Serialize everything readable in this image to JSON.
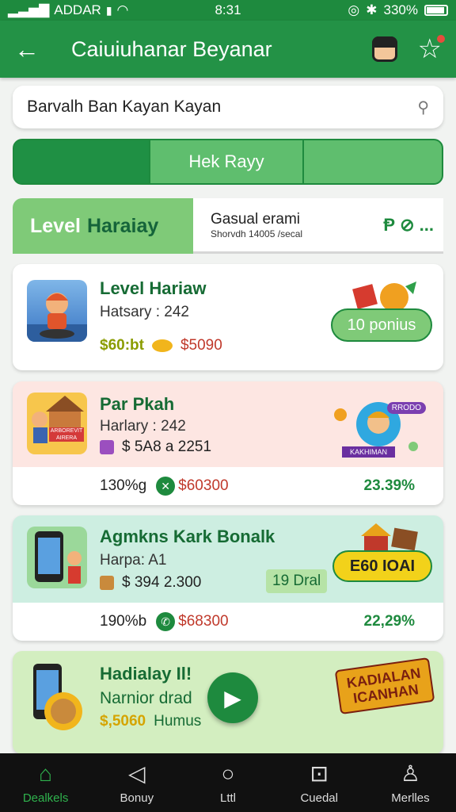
{
  "status_bar": {
    "carrier": "ADDAR",
    "time": "8:31",
    "battery": "330%"
  },
  "app_bar": {
    "title": "Caiuiuhanar Beyanar",
    "back_icon": "arrow-left-icon",
    "avatar_icon": "avatar-icon",
    "star_icon": "star-icon"
  },
  "search": {
    "value": "Barvalh Ban Kayan Kayan",
    "icon": "search-icon"
  },
  "segments": [
    "",
    "Hek Rayy",
    ""
  ],
  "tabs": {
    "active_a": "Level",
    "active_b": "Haraiay",
    "other_title": "Gasual erami",
    "other_sub": "Shorvdh 14005 /secal",
    "other_icons": "Ᵽ ⊘ ..."
  },
  "cards": [
    {
      "title": "Level Hariaw",
      "subtitle": "Hatsary : 242",
      "gold": "$60:bt",
      "price": "$5090",
      "button": "10 ponius"
    },
    {
      "title": "Par Pkah",
      "subtitle": "Harlary : 242",
      "extra": "$ 5A8 a 2251",
      "thumb_label": "ARBOREVIT AIRERA",
      "badge": "RRODO",
      "ribbon": "KAKHIMAN",
      "footer_left": "130%g",
      "footer_price": "$60300",
      "footer_pct": "23.39%"
    },
    {
      "title": "Agmkns Kark Bonalk",
      "subtitle": "Harpa: A1",
      "extra": "$ 394 2.300",
      "tag": "19 Dral",
      "button": "E60 IOAI",
      "footer_left": "190%b",
      "footer_price": "$68300",
      "footer_pct": "22,29%"
    },
    {
      "title": "Hadialay Il!",
      "subtitle": "Narnior drad",
      "gold": "$,5060",
      "gold_suffix": "Humus",
      "art": "KADIALAN ICANHAN"
    }
  ],
  "bottom_nav": [
    {
      "label": "Dealkels",
      "icon": "home-icon"
    },
    {
      "label": "Bonuy",
      "icon": "triangle-back-icon"
    },
    {
      "label": "Lttl",
      "icon": "circle-icon"
    },
    {
      "label": "Cuedal",
      "icon": "bag-icon"
    },
    {
      "label": "Merlles",
      "icon": "user-icon"
    }
  ],
  "colors": {
    "primary": "#239246",
    "accent_light": "#7fca78",
    "price_red": "#c0392b",
    "gold": "#8a9c00"
  }
}
